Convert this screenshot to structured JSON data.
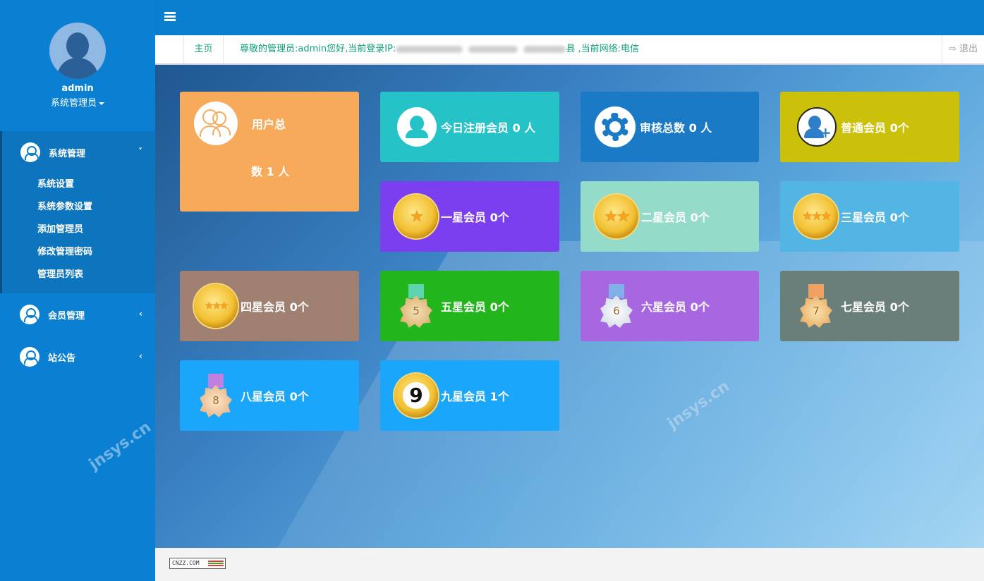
{
  "user": {
    "name": "admin",
    "role": "系统管理员"
  },
  "sidebar": {
    "groups": [
      {
        "label": "系统管理",
        "arrow": "˅",
        "items": [
          "系统设置",
          "系统参数设置",
          "添加管理员",
          "修改管理密码",
          "管理员列表"
        ]
      },
      {
        "label": "会员管理",
        "arrow": "‹"
      },
      {
        "label": "站公告",
        "arrow": "‹"
      }
    ]
  },
  "tabs": {
    "home": "主页",
    "welcome_prefix": "尊敬的管理员:admin您好,当前登录IP:",
    "welcome_suffix": "县 ,当前网络:电信",
    "logout": "退出"
  },
  "cards": [
    {
      "label_line1": "用户总",
      "label_line2": "数 1 人",
      "color": "#f7ab5a"
    },
    {
      "label": "今日注册会员 0 人",
      "color": "#25c3c7"
    },
    {
      "label": "审核总数 0 人",
      "color": "#1b7ac6"
    },
    {
      "label": "普通会员 0个",
      "color": "#ccc10a"
    },
    {
      "label": "一星会员 0个",
      "color": "#7b3ff0"
    },
    {
      "label": "二星会员 0个",
      "color": "#94dcc9"
    },
    {
      "label": "三星会员 0个",
      "color": "#53b5e3"
    },
    {
      "label": "四星会员 0个",
      "color": "#a08070"
    },
    {
      "label": "五星会员 0个",
      "color": "#22b51c",
      "medal": "5"
    },
    {
      "label": "六星会员 0个",
      "color": "#a667e0",
      "medal": "6"
    },
    {
      "label": "七星会员 0个",
      "color": "#6a7f79",
      "medal": "7"
    },
    {
      "label": "八星会员 0个",
      "color": "#19a6fb",
      "medal": "8"
    },
    {
      "label": "九星会员 1个",
      "color": "#19a6fb",
      "badge": "9"
    }
  ],
  "footer": {
    "cnzz": "CNZZ.COM"
  },
  "watermark": "jnsys.cn"
}
